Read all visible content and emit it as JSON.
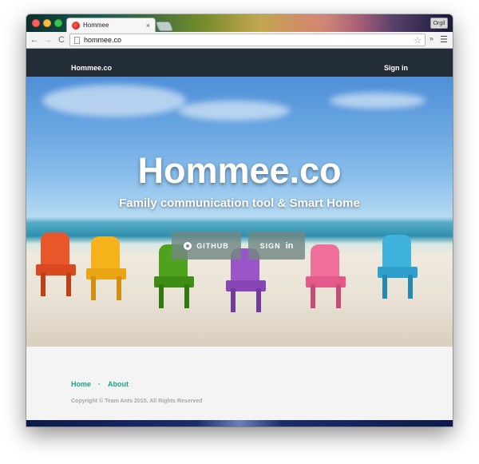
{
  "browser": {
    "tab_title": "Hommee",
    "tab_close": "×",
    "profile_label": "Orgil",
    "url": "hommee.co",
    "back_icon": "←",
    "forward_icon": "→",
    "reload_icon": "C",
    "star_icon": "☆",
    "overflow_icon": "»",
    "menu_icon": "☰"
  },
  "navbar": {
    "brand": "Hommee.co",
    "signin_label": "Sign in",
    "background": "#232d37"
  },
  "hero": {
    "title": "Hommee.co",
    "subtitle": "Family communication tool & Smart Home",
    "github_label": "GITHUB",
    "signin_label": "SIGN",
    "signin_icon_text": "in"
  },
  "footer": {
    "links": [
      "Home",
      "About"
    ],
    "separator": "·",
    "copyright": "Copyright © Team Ants 2015. All Rights Reserved",
    "link_color": "#1aa582"
  }
}
